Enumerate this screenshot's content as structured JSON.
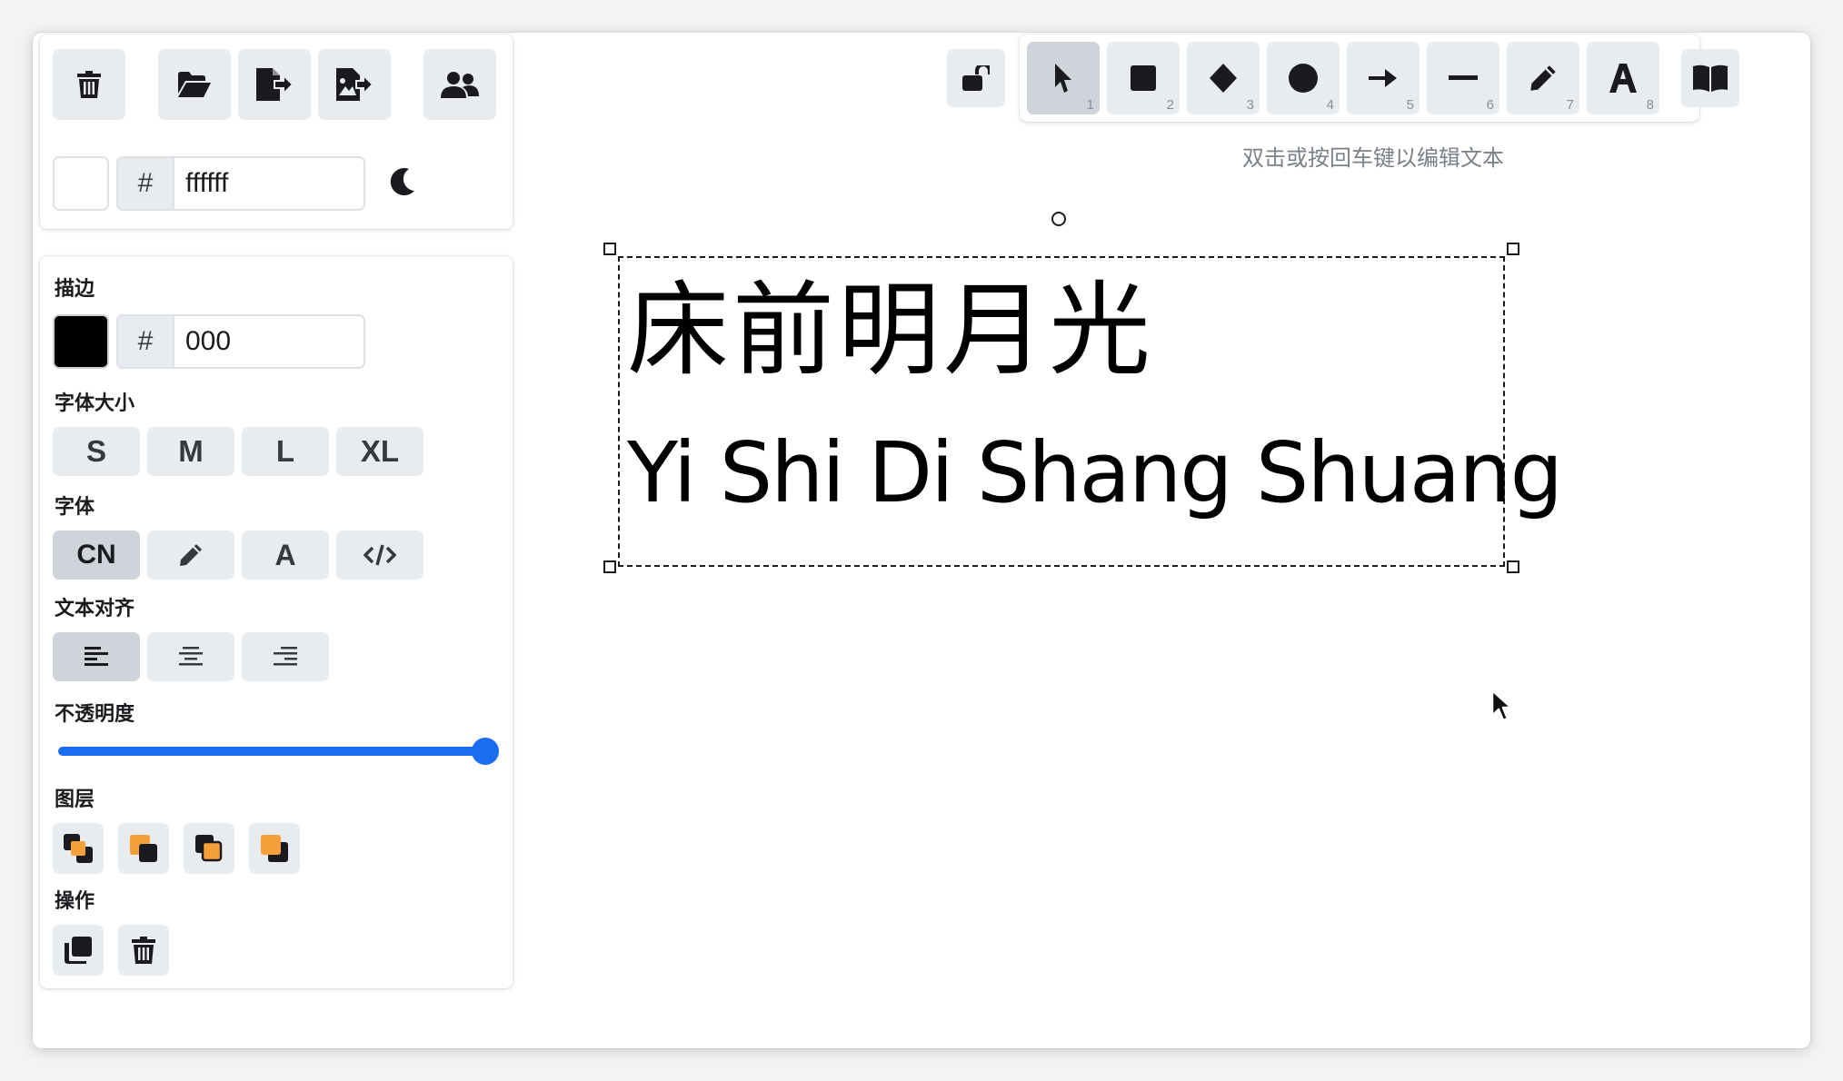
{
  "top_panel": {
    "buttons": [
      {
        "name": "delete-all-button",
        "icon": "trash-icon"
      },
      {
        "name": "open-button",
        "icon": "folder-open-icon"
      },
      {
        "name": "export-button",
        "icon": "file-export-icon"
      },
      {
        "name": "export-image-button",
        "icon": "file-image-export-icon"
      },
      {
        "name": "collaborate-button",
        "icon": "users-icon"
      }
    ],
    "background": {
      "hash": "#",
      "value": "ffffff",
      "color": "#ffffff"
    },
    "theme_icon": "moon-icon"
  },
  "props": {
    "stroke_label": "描边",
    "stroke": {
      "hash": "#",
      "value": "000",
      "color": "#000000"
    },
    "font_size_label": "字体大小",
    "font_sizes": [
      "S",
      "M",
      "L",
      "XL"
    ],
    "font_label": "字体",
    "fonts": [
      "CN",
      "pencil-icon",
      "A",
      "code-icon"
    ],
    "fonts_selected": "CN",
    "align_label": "文本对齐",
    "align_options": [
      "align-left-icon",
      "align-center-icon",
      "align-right-icon"
    ],
    "align_selected": "left",
    "opacity_label": "不透明度",
    "opacity": 1.0,
    "layers_label": "图层",
    "layer_buttons": [
      "send-to-back-icon",
      "send-backward-icon",
      "bring-forward-icon",
      "bring-to-front-icon"
    ],
    "actions_label": "操作",
    "action_buttons": [
      "duplicate-icon",
      "delete-icon"
    ]
  },
  "toolbar": {
    "lock_icon": "unlock-icon",
    "tools": [
      {
        "icon": "pointer-icon",
        "num": "1"
      },
      {
        "icon": "rectangle-icon",
        "num": "2"
      },
      {
        "icon": "diamond-icon",
        "num": "3"
      },
      {
        "icon": "ellipse-icon",
        "num": "4"
      },
      {
        "icon": "arrow-icon",
        "num": "5"
      },
      {
        "icon": "line-icon",
        "num": "6"
      },
      {
        "icon": "pencil-icon",
        "num": "7"
      },
      {
        "icon": "text-icon",
        "num": "8"
      }
    ],
    "selected_tool": "1",
    "library_icon": "book-open-icon",
    "hint": "双击或按回车键以编辑文本"
  },
  "canvas": {
    "line1": "床前明月光",
    "line2": "Yi Shi Di Shang Shuang"
  },
  "colors": {
    "accent": "#1a6cf0",
    "orange": "#f6a03c"
  }
}
